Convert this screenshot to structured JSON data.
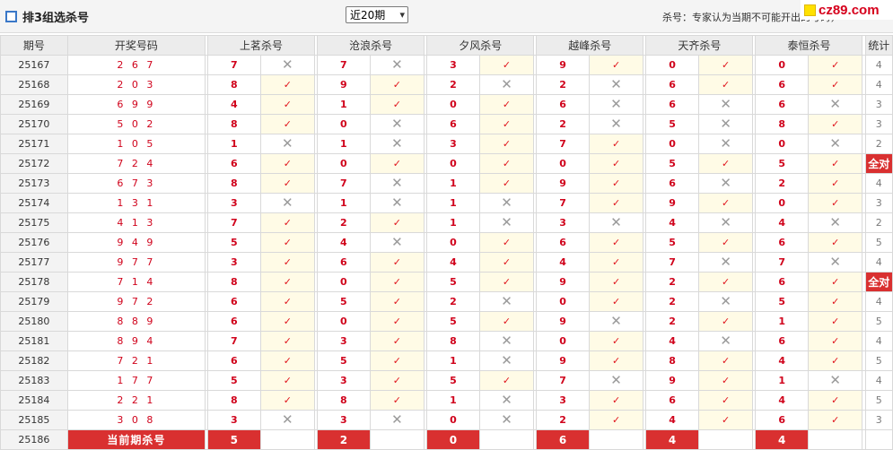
{
  "header": {
    "title": "排3组选杀号",
    "period_select": "近20期",
    "note": "杀号：专家认为当期不可能开出的号码，",
    "logo": "cz89.com"
  },
  "columns": {
    "period": "期号",
    "draw": "开奖号码",
    "experts": [
      "上茗杀号",
      "沧浪杀号",
      "夕风杀号",
      "越峰杀号",
      "天齐杀号",
      "泰恒杀号"
    ],
    "stat": "统计"
  },
  "marks": {
    "ok": "✓",
    "no": "✕"
  },
  "rows": [
    {
      "issue": "25167",
      "draw": "2 6 7",
      "kills": [
        7,
        7,
        3,
        9,
        0,
        0
      ],
      "res": [
        0,
        0,
        1,
        1,
        1,
        1
      ],
      "stat": "4"
    },
    {
      "issue": "25168",
      "draw": "2 0 3",
      "kills": [
        8,
        9,
        2,
        2,
        6,
        6
      ],
      "res": [
        1,
        1,
        0,
        0,
        1,
        1
      ],
      "stat": "4"
    },
    {
      "issue": "25169",
      "draw": "6 9 9",
      "kills": [
        4,
        1,
        0,
        6,
        6,
        6
      ],
      "res": [
        1,
        1,
        1,
        0,
        0,
        0
      ],
      "stat": "3"
    },
    {
      "issue": "25170",
      "draw": "5 0 2",
      "kills": [
        8,
        0,
        6,
        2,
        5,
        8
      ],
      "res": [
        1,
        0,
        1,
        0,
        0,
        1
      ],
      "stat": "3"
    },
    {
      "issue": "25171",
      "draw": "1 0 5",
      "kills": [
        1,
        1,
        3,
        7,
        0,
        0
      ],
      "res": [
        0,
        0,
        1,
        1,
        0,
        0
      ],
      "stat": "2"
    },
    {
      "issue": "25172",
      "draw": "7 2 4",
      "kills": [
        6,
        0,
        0,
        0,
        5,
        5
      ],
      "res": [
        1,
        1,
        1,
        1,
        1,
        1
      ],
      "stat": "全对"
    },
    {
      "issue": "25173",
      "draw": "6 7 3",
      "kills": [
        8,
        7,
        1,
        9,
        6,
        2
      ],
      "res": [
        1,
        0,
        1,
        1,
        0,
        1
      ],
      "stat": "4"
    },
    {
      "issue": "25174",
      "draw": "1 3 1",
      "kills": [
        3,
        1,
        1,
        7,
        9,
        0
      ],
      "res": [
        0,
        0,
        0,
        1,
        1,
        1
      ],
      "stat": "3"
    },
    {
      "issue": "25175",
      "draw": "4 1 3",
      "kills": [
        7,
        2,
        1,
        3,
        4,
        4
      ],
      "res": [
        1,
        1,
        0,
        0,
        0,
        0
      ],
      "stat": "2"
    },
    {
      "issue": "25176",
      "draw": "9 4 9",
      "kills": [
        5,
        4,
        0,
        6,
        5,
        6
      ],
      "res": [
        1,
        0,
        1,
        1,
        1,
        1
      ],
      "stat": "5"
    },
    {
      "issue": "25177",
      "draw": "9 7 7",
      "kills": [
        3,
        6,
        4,
        4,
        7,
        7
      ],
      "res": [
        1,
        1,
        1,
        1,
        0,
        0
      ],
      "stat": "4"
    },
    {
      "issue": "25178",
      "draw": "7 1 4",
      "kills": [
        8,
        0,
        5,
        9,
        2,
        6
      ],
      "res": [
        1,
        1,
        1,
        1,
        1,
        1
      ],
      "stat": "全对"
    },
    {
      "issue": "25179",
      "draw": "9 7 2",
      "kills": [
        6,
        5,
        2,
        0,
        2,
        5
      ],
      "res": [
        1,
        1,
        0,
        1,
        0,
        1
      ],
      "stat": "4"
    },
    {
      "issue": "25180",
      "draw": "8 8 9",
      "kills": [
        6,
        0,
        5,
        9,
        2,
        1
      ],
      "res": [
        1,
        1,
        1,
        0,
        1,
        1
      ],
      "stat": "5"
    },
    {
      "issue": "25181",
      "draw": "8 9 4",
      "kills": [
        7,
        3,
        8,
        0,
        4,
        6
      ],
      "res": [
        1,
        1,
        0,
        1,
        0,
        1
      ],
      "stat": "4"
    },
    {
      "issue": "25182",
      "draw": "7 2 1",
      "kills": [
        6,
        5,
        1,
        9,
        8,
        4
      ],
      "res": [
        1,
        1,
        0,
        1,
        1,
        1
      ],
      "stat": "5"
    },
    {
      "issue": "25183",
      "draw": "1 7 7",
      "kills": [
        5,
        3,
        5,
        7,
        9,
        1
      ],
      "res": [
        1,
        1,
        1,
        0,
        1,
        0
      ],
      "stat": "4"
    },
    {
      "issue": "25184",
      "draw": "2 2 1",
      "kills": [
        8,
        8,
        1,
        3,
        6,
        4
      ],
      "res": [
        1,
        1,
        0,
        1,
        1,
        1
      ],
      "stat": "5"
    },
    {
      "issue": "25185",
      "draw": "3 0 8",
      "kills": [
        3,
        3,
        0,
        2,
        4,
        6
      ],
      "res": [
        0,
        0,
        0,
        1,
        1,
        1
      ],
      "stat": "3"
    }
  ],
  "current": {
    "issue": "25186",
    "label": "当前期杀号",
    "kills": [
      5,
      2,
      0,
      6,
      4,
      4
    ]
  }
}
